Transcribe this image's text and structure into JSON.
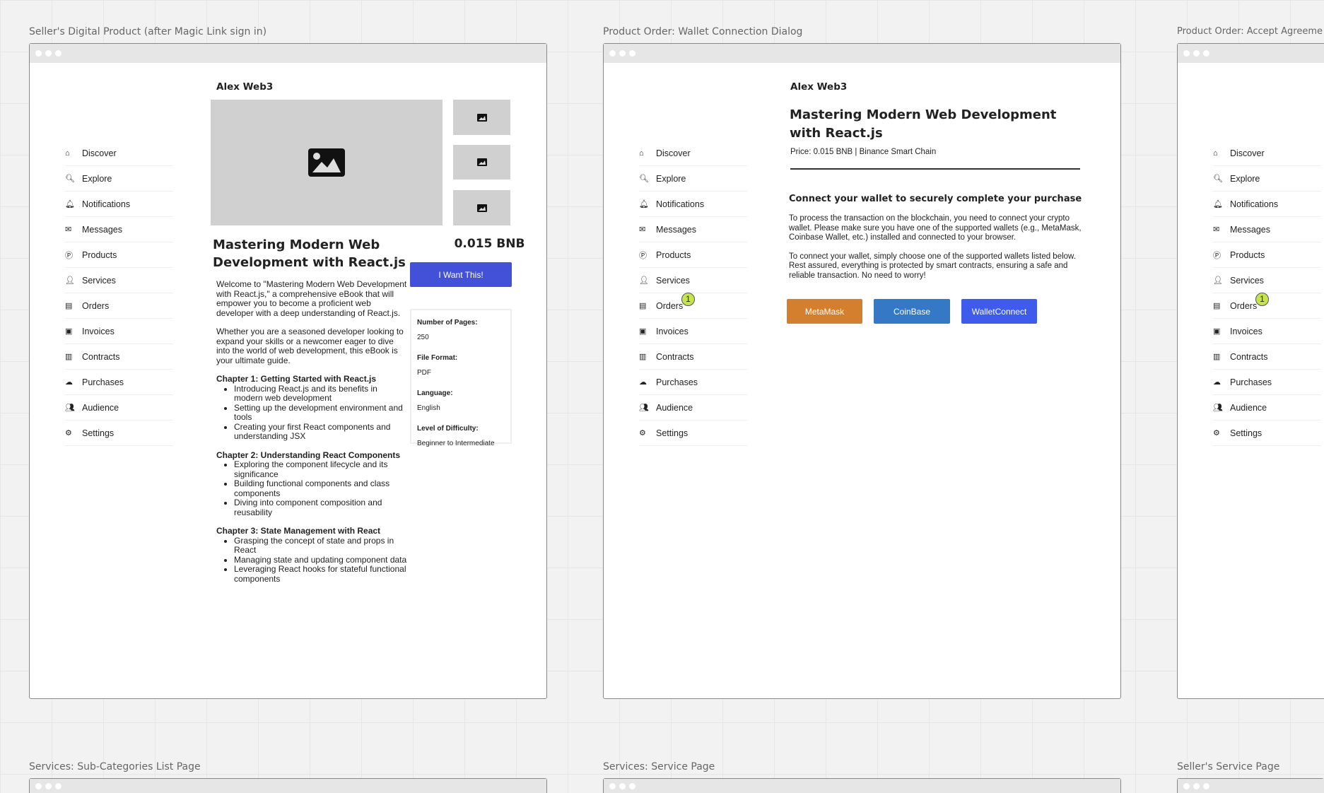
{
  "frames": [
    {
      "label": "Seller's Digital Product (after Magic Link sign in)"
    },
    {
      "label": "Product Order: Wallet Connection Dialog"
    },
    {
      "label": "Product Order: Accept Agreeme"
    },
    {
      "label": "Services: Sub-Categories List Page"
    },
    {
      "label": "Services: Service Page"
    },
    {
      "label": "Seller's Service Page"
    }
  ],
  "sidebar": {
    "items": [
      {
        "label": "Discover",
        "icon": "home-icon",
        "glyph": "⌂"
      },
      {
        "label": "Explore",
        "icon": "search-icon",
        "glyph": "🔍︎"
      },
      {
        "label": "Notifications",
        "icon": "bell-icon",
        "glyph": "🔔︎"
      },
      {
        "label": "Messages",
        "icon": "envelope-icon",
        "glyph": "✉"
      },
      {
        "label": "Products",
        "icon": "product-icon",
        "glyph": "Ⓟ"
      },
      {
        "label": "Services",
        "icon": "user-tie-icon",
        "glyph": "👤︎"
      },
      {
        "label": "Orders",
        "icon": "receipt-icon",
        "glyph": "▤"
      },
      {
        "label": "Invoices",
        "icon": "invoice-icon",
        "glyph": "▣"
      },
      {
        "label": "Contracts",
        "icon": "contract-icon",
        "glyph": "▥"
      },
      {
        "label": "Purchases",
        "icon": "cloud-icon",
        "glyph": "☁"
      },
      {
        "label": "Audience",
        "icon": "users-icon",
        "glyph": "👥︎"
      },
      {
        "label": "Settings",
        "icon": "gear-icon",
        "glyph": "⚙"
      }
    ],
    "orders_badge": "1"
  },
  "product": {
    "seller": "Alex Web3",
    "title": "Mastering Modern Web Development with React.js",
    "price": "0.015 BNB",
    "cta": "I Want This!",
    "intro": "Welcome to \"Mastering Modern Web Development with React.js,\" a comprehensive eBook that will empower you to become a proficient web developer with a deep understanding of React.js.",
    "intro2": "Whether you are a seasoned developer looking to expand your skills or a newcomer eager to dive into the world of web development, this eBook is your ultimate guide.",
    "chapters": [
      {
        "title": "Chapter 1: Getting Started with React.js",
        "items": [
          "Introducing React.js and its benefits in modern web development",
          "Setting up the development environment and tools",
          "Creating your first React components and understanding JSX"
        ]
      },
      {
        "title": "Chapter 2: Understanding React Components",
        "items": [
          "Exploring the component lifecycle and its significance",
          "Building functional components and class components",
          "Diving into component composition and reusability"
        ]
      },
      {
        "title": "Chapter 3: State Management with React",
        "items": [
          "Grasping the concept of state and props in React",
          "Managing state and updating component data",
          "Leveraging React hooks for stateful functional components"
        ]
      }
    ],
    "specs": [
      {
        "label": "Number of Pages:",
        "value": "250"
      },
      {
        "label": "File Format:",
        "value": "PDF"
      },
      {
        "label": "Language:",
        "value": "English"
      },
      {
        "label": "Level of Difficulty:",
        "value": "Beginner to Intermediate"
      }
    ]
  },
  "wallet": {
    "seller": "Alex Web3",
    "title": "Mastering Modern Web Development with React.js",
    "price_line": "Price: 0.015 BNB | Binance Smart Chain",
    "heading": "Connect your wallet to securely complete your purchase",
    "para1": "To process the transaction on the blockchain, you need to connect your crypto wallet. Please make sure you have one of the supported wallets (e.g., MetaMask, Coinbase Wallet, etc.) installed and connected to your browser.",
    "para2": "To connect your wallet, simply choose one of the supported wallets listed below. Rest assured, everything is protected by smart contracts, ensuring a safe and reliable transaction. No need to worry!",
    "buttons": [
      {
        "label": "MetaMask",
        "color": "#d47f2e"
      },
      {
        "label": "CoinBase",
        "color": "#3478c6"
      },
      {
        "label": "WalletConnect",
        "color": "#3e5bec"
      }
    ]
  },
  "colors": {
    "cta": "#4351d8",
    "badge": "#c7e34a"
  }
}
